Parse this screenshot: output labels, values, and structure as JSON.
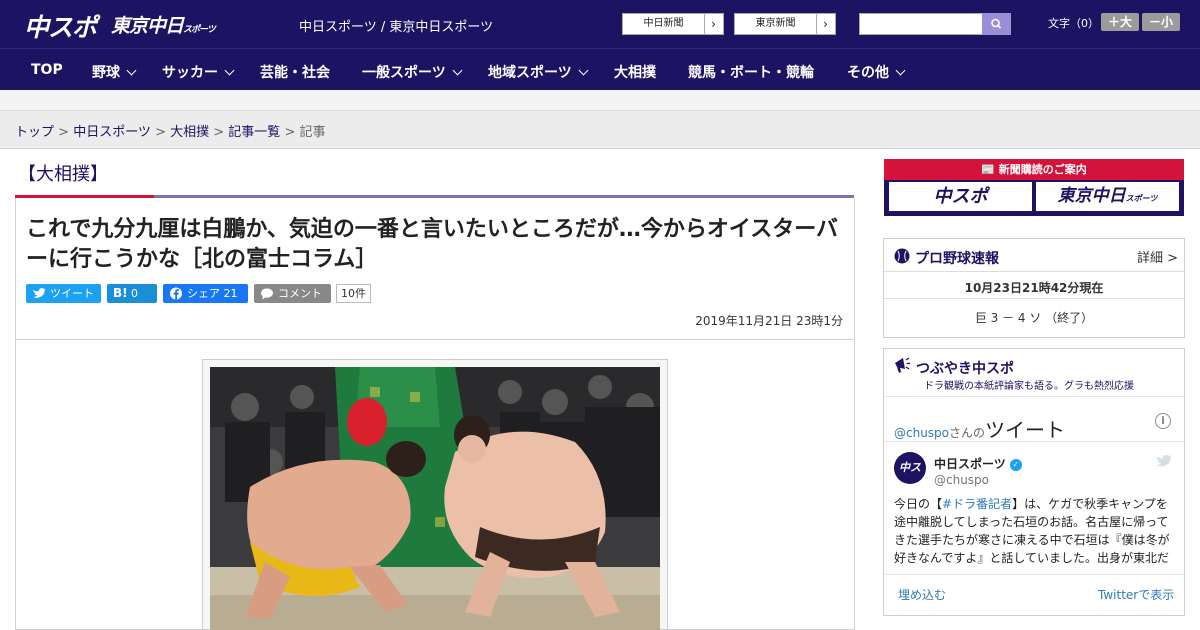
{
  "header": {
    "logo_main": "中スポ",
    "logo_sub": "東京中日",
    "logo_sub_small": "スポーツ",
    "site_title": "中日スポーツ / 東京中日スポーツ",
    "paper_buttons": [
      "中日新聞",
      "東京新聞"
    ],
    "search_placeholder": "",
    "font_size_label": "文字（0）",
    "font_up": "＋大",
    "font_down": "－小"
  },
  "nav": {
    "items": [
      {
        "label": "TOP",
        "dropdown": false
      },
      {
        "label": "野球",
        "dropdown": true
      },
      {
        "label": "サッカー",
        "dropdown": true
      },
      {
        "label": "芸能・社会",
        "dropdown": false
      },
      {
        "label": "一般スポーツ",
        "dropdown": true
      },
      {
        "label": "地域スポーツ",
        "dropdown": true
      },
      {
        "label": "大相撲",
        "dropdown": false
      },
      {
        "label": "競馬・ボート・競輪",
        "dropdown": false
      },
      {
        "label": "その他",
        "dropdown": true
      }
    ]
  },
  "breadcrumb": {
    "items": [
      "トップ",
      "中日スポーツ",
      "大相撲",
      "記事一覧"
    ],
    "current": "記事",
    "separator": " > "
  },
  "article": {
    "category": "【大相撲】",
    "headline": "これで九分九厘は白鵬か、気迫の一番と言いたいところだが…今からオイスターバーに行こうかな［北の富士コラム］",
    "share": {
      "tweet": "ツイート",
      "hatena": "0",
      "hatena_icon": "B!",
      "facebook": "シェア 21",
      "comment": "コメント",
      "comment_count": "10件"
    },
    "date": "2019年11月21日 23時1分"
  },
  "sidebar": {
    "subscription": {
      "header": "新聞購読のご案内",
      "logo1": "中スポ",
      "logo2": "東京中日",
      "logo2_small": "スポーツ"
    },
    "baseball": {
      "title": "プロ野球速報",
      "detail": "詳細 >",
      "timestamp": "10月23日21時42分現在",
      "score": "巨 3 － 4 ソ （終了）"
    },
    "twitter": {
      "title": "つぶやき中スポ",
      "subtitle": "ドラ観戦の本紙評論家も語る。グラも熱烈応援",
      "handle_prefix": "@chuspo",
      "handle_suffix": "さんの",
      "tweets_label": "ツイート",
      "user_name": "中日スポーツ",
      "user_handle": "@chuspo",
      "avatar_text": "中スポ",
      "tweet_pre": "今日の【",
      "tweet_hashtag": "#ドラ番記者",
      "tweet_post": "】は、ケガで秋季キャンプを途中離脱してしまった石垣のお話。名古屋に帰ってきた選手たちが寒さに凍える中で石垣は『僕は冬が好きなんですよ』と話していました。出身が東北だからでしょうか。",
      "embed": "埋め込む",
      "view_on_twitter": "Twitterで表示"
    }
  },
  "colors": {
    "brand_navy": "#1d1363",
    "accent_red": "#d3133a",
    "twitter_blue": "#1da1f2",
    "facebook_blue": "#1877f2"
  }
}
